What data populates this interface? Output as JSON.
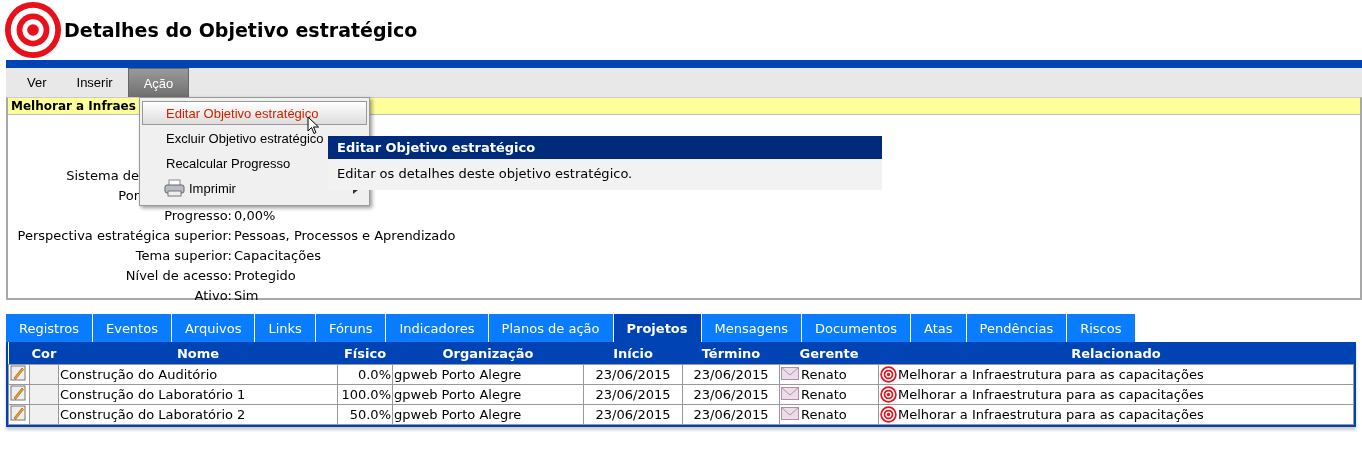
{
  "page": {
    "title": "Detalhes do Objetivo estratégico"
  },
  "menubar": [
    {
      "label": "Ver",
      "selected": false
    },
    {
      "label": "Inserir",
      "selected": false
    },
    {
      "label": "Ação",
      "selected": true
    }
  ],
  "menu": [
    {
      "label": "Editar Objetivo estratégico",
      "kind": "item",
      "selected": true
    },
    {
      "label": "Excluir Objetivo estratégico",
      "kind": "item",
      "selected": false
    },
    {
      "label": "Recalcular Progresso",
      "kind": "item",
      "selected": false
    },
    {
      "label": "Imprimir",
      "kind": "submenu",
      "selected": false
    }
  ],
  "tooltip": {
    "title": "Editar Objetivo estratégico",
    "text": "Editar os detalhes deste objetivo estratégico."
  },
  "details": {
    "heading": "Melhorar a Infraes",
    "fields": [
      {
        "label": "Sistema de",
        "kind": "cut"
      },
      {
        "label": "Por",
        "kind": "cut"
      },
      {
        "label": "Progresso:",
        "value": "0,00%",
        "kind": "full"
      },
      {
        "label": "Perspectiva estratégica superior:",
        "value": "Pessoas, Processos e Aprendizado",
        "kind": "full"
      },
      {
        "label": "Tema superior:",
        "value": "Capacitações",
        "kind": "full"
      },
      {
        "label": "Nível de acesso:",
        "value": "Protegido",
        "kind": "full"
      },
      {
        "label": "Ativo:",
        "value": "Sim",
        "kind": "full"
      }
    ]
  },
  "tabs": [
    {
      "label": "Registros",
      "selected": false
    },
    {
      "label": "Eventos",
      "selected": false
    },
    {
      "label": "Arquivos",
      "selected": false
    },
    {
      "label": "Links",
      "selected": false
    },
    {
      "label": "Fóruns",
      "selected": false
    },
    {
      "label": "Indicadores",
      "selected": false
    },
    {
      "label": "Planos de ação",
      "selected": false
    },
    {
      "label": "Projetos",
      "selected": true
    },
    {
      "label": "Mensagens",
      "selected": false
    },
    {
      "label": "Documentos",
      "selected": false
    },
    {
      "label": "Atas",
      "selected": false
    },
    {
      "label": "Pendências",
      "selected": false
    },
    {
      "label": "Riscos",
      "selected": false
    }
  ],
  "table": {
    "columns": [
      "Cor",
      "Nome",
      "Físico",
      "Organização",
      "Início",
      "Término",
      "Gerente",
      "Relacionado"
    ],
    "rows": [
      {
        "nome": "Construção do Auditório",
        "fisico": "0.0%",
        "organizacao": "gpweb Porto Alegre",
        "inicio": "23/06/2015",
        "termino": "23/06/2015",
        "gerente": "Renato",
        "relacionado": "Melhorar a Infraestrutura para as capacitações"
      },
      {
        "nome": "Construção do Laboratório 1",
        "fisico": "100.0%",
        "organizacao": "gpweb Porto Alegre",
        "inicio": "23/06/2015",
        "termino": "23/06/2015",
        "gerente": "Renato",
        "relacionado": "Melhorar a Infraestrutura para as capacitações"
      },
      {
        "nome": "Construção do Laboratório 2",
        "fisico": "50.0%",
        "organizacao": "gpweb Porto Alegre",
        "inicio": "23/06/2015",
        "termino": "23/06/2015",
        "gerente": "Renato",
        "relacionado": "Melhorar a Infraestrutura para as capacitações"
      }
    ]
  }
}
